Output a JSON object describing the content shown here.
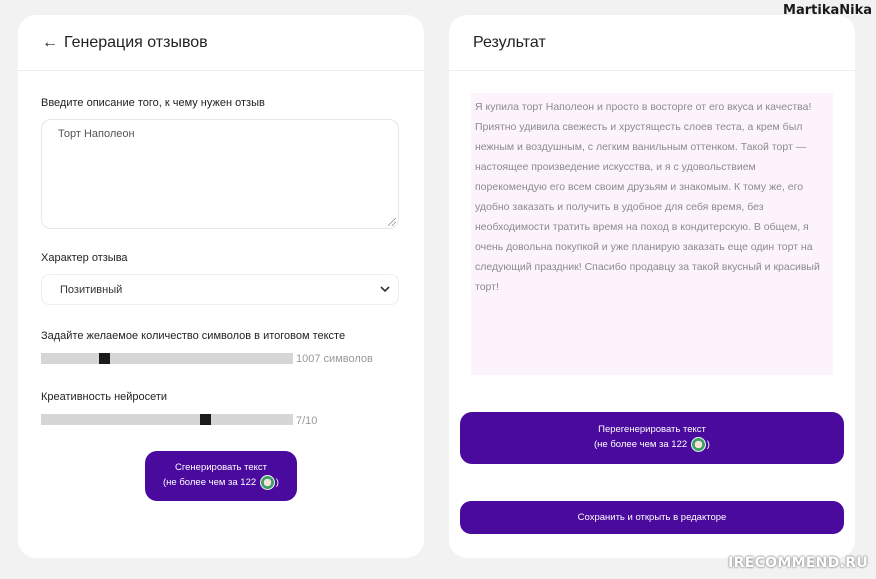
{
  "watermark_top": "MartikaNika",
  "watermark_bottom": "IRECOMMEND.RU",
  "left_panel": {
    "back_icon": "←",
    "title": "Генерация отзывов",
    "description_label": "Введите описание того, к чему нужен отзыв",
    "description_value": "Торт Наполеон",
    "tone_label": "Характер отзыва",
    "tone_value": "Позитивный",
    "length_label": "Задайте желаемое количество символов в итоговом тексте",
    "length_value": "1007 символов",
    "length_fraction": 0.24,
    "creativity_label": "Креативность нейросети",
    "creativity_value": "7/10",
    "creativity_fraction": 0.66,
    "generate_button": {
      "line1": "Сгенерировать текст",
      "line2_prefix": "(не более чем за 122",
      "line2_suffix": ")",
      "coin_icon": "coin-icon"
    }
  },
  "right_panel": {
    "title": "Результат",
    "result_text": "Я купила торт Наполеон и просто в восторге от его вкуса и качества! Приятно удивила свежесть и хрустящесть слоев теста, а крем был нежным и воздушным, с легким ванильным оттенком. Такой торт — настоящее произведение искусства, и я с удовольствием порекомендую его всем своим друзьям и знакомым. К тому же, его удобно заказать и получить в удобное для себя время, без необходимости тратить время на поход в кондитерскую. В общем, я очень довольна покупкой и уже планирую заказать еще один торт на следующий праздник! Спасибо продавцу за такой вкусный и красивый торт!",
    "regenerate_button": {
      "line1": "Перегенерировать текст",
      "line2_prefix": "(не более чем за 122",
      "line2_suffix": ")"
    },
    "save_button": "Сохранить и открыть в редакторе"
  },
  "colors": {
    "accent": "#4a0a9e",
    "background": "#f2f2f2",
    "result_bg": "#fcf3fd"
  }
}
